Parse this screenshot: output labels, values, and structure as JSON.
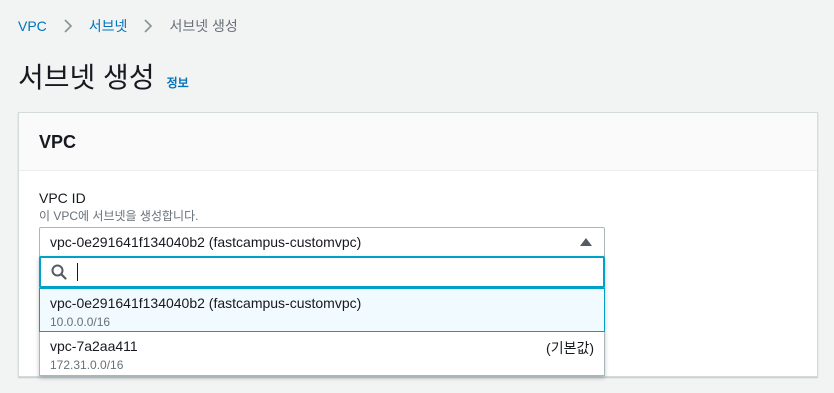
{
  "breadcrumb": {
    "items": [
      "VPC",
      "서브넷",
      "서브넷 생성"
    ]
  },
  "page": {
    "title": "서브넷 생성",
    "info_link": "정보"
  },
  "panel": {
    "title": "VPC",
    "field": {
      "label": "VPC ID",
      "description": "이 VPC에 서브넷을 생성합니다.",
      "selected_value": "vpc-0e291641f134040b2 (fastcampus-customvpc)"
    },
    "search": {
      "value": "",
      "placeholder": ""
    },
    "options": [
      {
        "label": "vpc-0e291641f134040b2 (fastcampus-customvpc)",
        "cidr": "10.0.0.0/16",
        "tag": "",
        "selected": true
      },
      {
        "label": "vpc-7a2aa411",
        "cidr": "172.31.0.0/16",
        "tag": "(기본값)",
        "selected": false
      }
    ]
  },
  "colors": {
    "link": "#0073bb",
    "focus": "#00a1c9",
    "selected_bg": "#f1faff",
    "page_bg": "#f2f3f3"
  },
  "icons": [
    "chevron-right-icon",
    "caret-up-icon",
    "search-icon"
  ]
}
